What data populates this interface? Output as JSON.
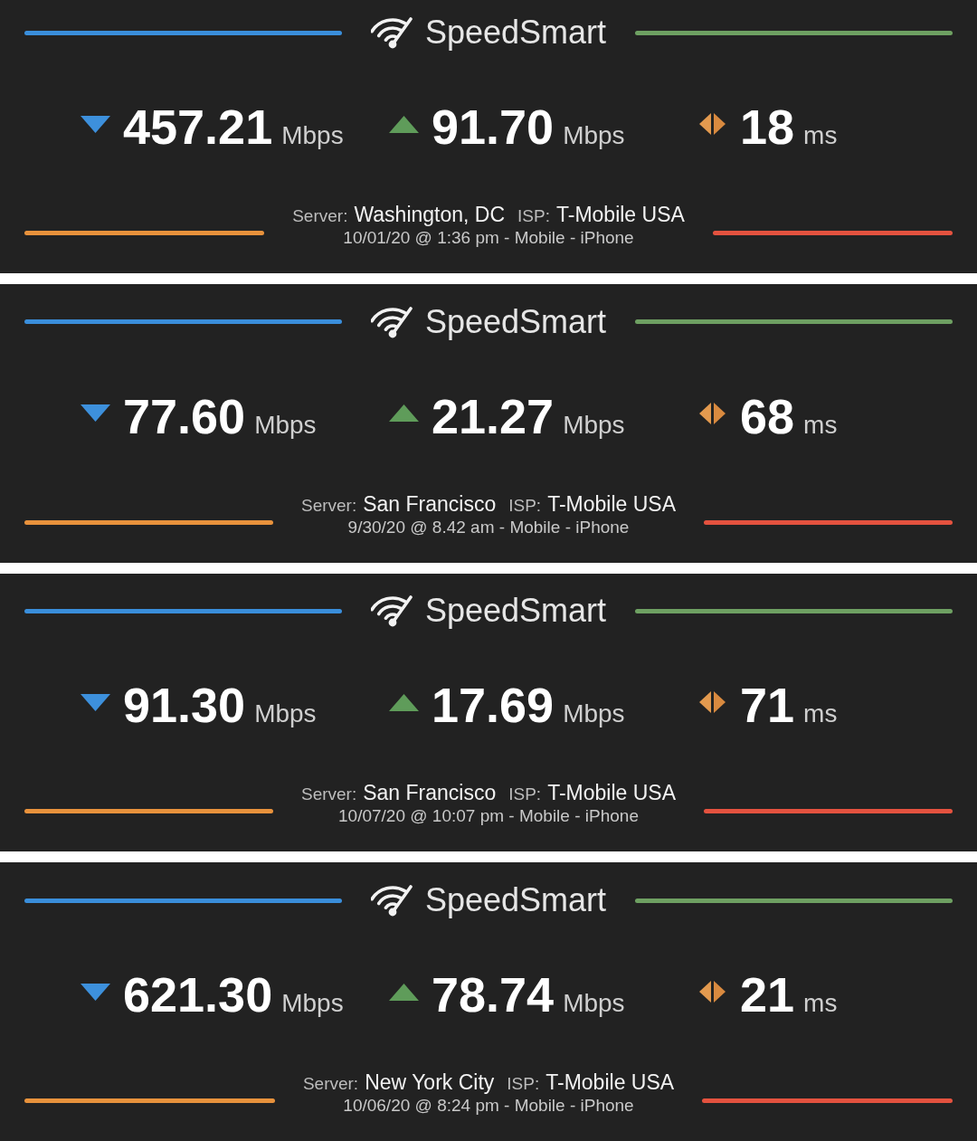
{
  "results": [
    {
      "app_name": "SpeedSmart",
      "metrics": [
        {
          "kind": "download",
          "value": "457.21",
          "unit": "Mbps"
        },
        {
          "kind": "upload",
          "value": "91.70",
          "unit": "Mbps"
        },
        {
          "kind": "ping",
          "value": "18",
          "unit": "ms"
        }
      ],
      "server_label": "Server:",
      "server": "Washington, DC",
      "isp_label": "ISP:",
      "isp": "T-Mobile USA",
      "details": "10/01/20 @ 1:36 pm - Mobile - iPhone"
    },
    {
      "app_name": "SpeedSmart",
      "metrics": [
        {
          "kind": "download",
          "value": "77.60",
          "unit": "Mbps"
        },
        {
          "kind": "upload",
          "value": "21.27",
          "unit": "Mbps"
        },
        {
          "kind": "ping",
          "value": "68",
          "unit": "ms"
        }
      ],
      "server_label": "Server:",
      "server": "San Francisco",
      "isp_label": "ISP:",
      "isp": "T-Mobile USA",
      "details": "9/30/20 @ 8.42 am - Mobile - iPhone"
    },
    {
      "app_name": "SpeedSmart",
      "metrics": [
        {
          "kind": "download",
          "value": "91.30",
          "unit": "Mbps"
        },
        {
          "kind": "upload",
          "value": "17.69",
          "unit": "Mbps"
        },
        {
          "kind": "ping",
          "value": "71",
          "unit": "ms"
        }
      ],
      "server_label": "Server:",
      "server": "San Francisco",
      "isp_label": "ISP:",
      "isp": "T-Mobile USA",
      "details": "10/07/20 @ 10:07 pm - Mobile - iPhone"
    },
    {
      "app_name": "SpeedSmart",
      "metrics": [
        {
          "kind": "download",
          "value": "621.30",
          "unit": "Mbps"
        },
        {
          "kind": "upload",
          "value": "78.74",
          "unit": "Mbps"
        },
        {
          "kind": "ping",
          "value": "21",
          "unit": "ms"
        }
      ],
      "server_label": "Server:",
      "server": "New York City",
      "isp_label": "ISP:",
      "isp": "T-Mobile USA",
      "details": "10/06/20 @ 8:24 pm - Mobile - iPhone"
    }
  ]
}
